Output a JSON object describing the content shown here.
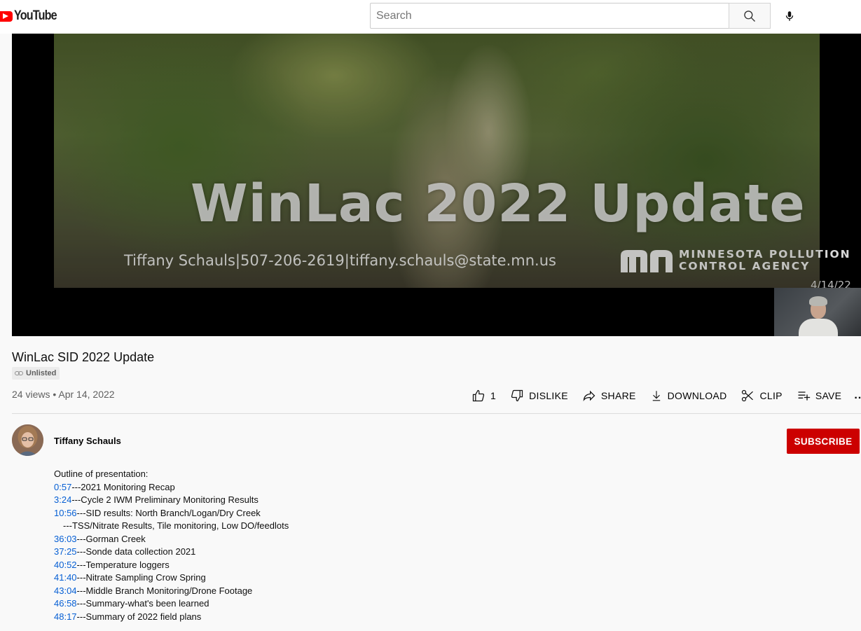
{
  "header": {
    "logo_text": "YouTube",
    "search_placeholder": "Search"
  },
  "player": {
    "overlay_title": "WinLac 2022 Update",
    "overlay_contact": "Tiffany Schauls|507-206-2619|tiffany.schauls@state.mn.us",
    "org_line1": "MINNESOTA POLLUTION",
    "org_line2": "CONTROL AGENCY",
    "overlay_date": "4/14/22"
  },
  "video": {
    "title": "WinLac SID 2022 Update",
    "visibility": "Unlisted",
    "meta": "24 views • Apr 14, 2022",
    "like_count": "1",
    "dislike_label": "DISLIKE",
    "share_label": "SHARE",
    "download_label": "DOWNLOAD",
    "clip_label": "CLIP",
    "save_label": "SAVE",
    "more_label": "..."
  },
  "channel": {
    "name": "Tiffany Schauls",
    "subscribe_label": "SUBSCRIBE"
  },
  "description": {
    "intro": "Outline of presentation:",
    "items": [
      {
        "ts": "0:57",
        "text": "---2021 Monitoring Recap"
      },
      {
        "ts": "3:24",
        "text": "---Cycle 2 IWM Preliminary Monitoring Results"
      },
      {
        "ts": "10:56",
        "text": "---SID results: North Branch/Logan/Dry Creek"
      },
      {
        "ts": "",
        "text": "---TSS/Nitrate Results, Tile monitoring, Low DO/feedlots"
      },
      {
        "ts": "36:03",
        "text": "---Gorman Creek"
      },
      {
        "ts": "37:25",
        "text": "---Sonde data collection 2021"
      },
      {
        "ts": "40:52",
        "text": "---Temperature loggers"
      },
      {
        "ts": "41:40",
        "text": "---Nitrate Sampling Crow Spring"
      },
      {
        "ts": "43:04",
        "text": "---Middle Branch Monitoring/Drone Footage"
      },
      {
        "ts": "46:58",
        "text": "---Summary-what's been learned"
      },
      {
        "ts": "48:17",
        "text": "---Summary of 2022 field plans"
      }
    ]
  },
  "colors": {
    "brand_red": "#ff0000",
    "subscribe_red": "#cc0000",
    "link_blue": "#065fd4"
  }
}
